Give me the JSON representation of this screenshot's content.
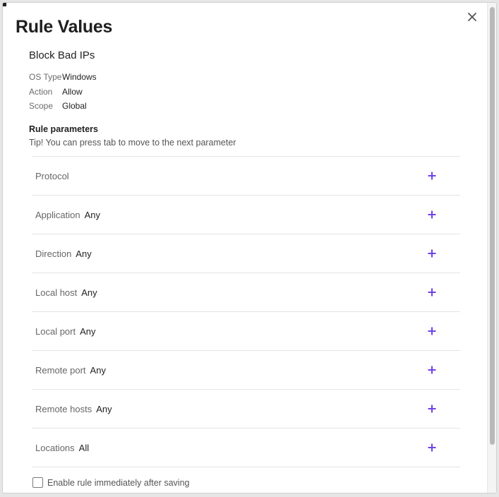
{
  "dialog": {
    "title": "Rule Values",
    "close_icon": "close-icon"
  },
  "rule": {
    "name": "Block Bad IPs",
    "meta": [
      {
        "key": "OS Type",
        "value": "Windows"
      },
      {
        "key": "Action",
        "value": "Allow"
      },
      {
        "key": "Scope",
        "value": "Global"
      }
    ]
  },
  "params": {
    "heading": "Rule parameters",
    "tip": "Tip! You can press tab to move to the next parameter",
    "add_icon": "plus-icon",
    "accent_color": "#6f42e8",
    "rows": [
      {
        "label": "Protocol",
        "value": ""
      },
      {
        "label": "Application",
        "value": "Any"
      },
      {
        "label": "Direction",
        "value": "Any"
      },
      {
        "label": "Local host",
        "value": "Any"
      },
      {
        "label": "Local port",
        "value": "Any"
      },
      {
        "label": "Remote port",
        "value": "Any"
      },
      {
        "label": "Remote hosts",
        "value": "Any"
      },
      {
        "label": "Locations",
        "value": "All"
      }
    ]
  },
  "enable": {
    "label": "Enable rule immediately after saving",
    "checked": false
  }
}
